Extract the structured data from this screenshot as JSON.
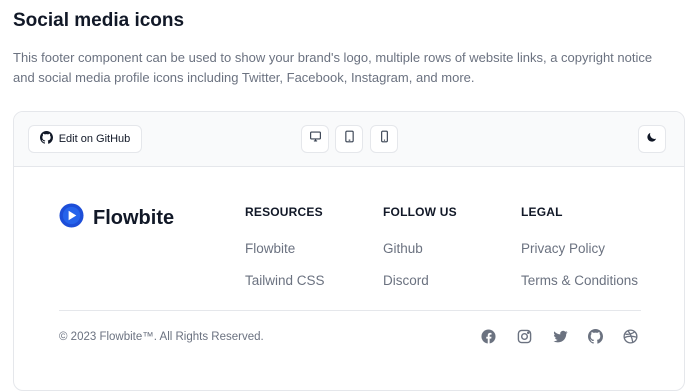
{
  "page": {
    "title": "Social media icons",
    "description": "This footer component can be used to show your brand's logo, multiple rows of website links, a copyright notice and social media profile icons including Twitter, Facebook, Instagram, and more."
  },
  "toolbar": {
    "github_button_label": "Edit on GitHub",
    "device_icons": [
      "desktop-icon",
      "tablet-icon",
      "mobile-icon"
    ],
    "dark_mode_icon": "moon-icon"
  },
  "footer": {
    "brand": {
      "name": "Flowbite",
      "logo_color": "#1d4ed8"
    },
    "columns": [
      {
        "heading": "Resources",
        "links": [
          "Flowbite",
          "Tailwind CSS"
        ]
      },
      {
        "heading": "Follow us",
        "links": [
          "Github",
          "Discord"
        ]
      },
      {
        "heading": "Legal",
        "links": [
          "Privacy Policy",
          "Terms & Conditions"
        ]
      }
    ],
    "copyright": "© 2023 Flowbite™. All Rights Reserved.",
    "social_icons": [
      "facebook-icon",
      "instagram-icon",
      "twitter-icon",
      "github-icon",
      "dribbble-icon"
    ]
  },
  "colors": {
    "text": "#111827",
    "muted": "#6b7280",
    "border": "#e5e7eb",
    "toolbar_bg": "#f9fafb"
  }
}
